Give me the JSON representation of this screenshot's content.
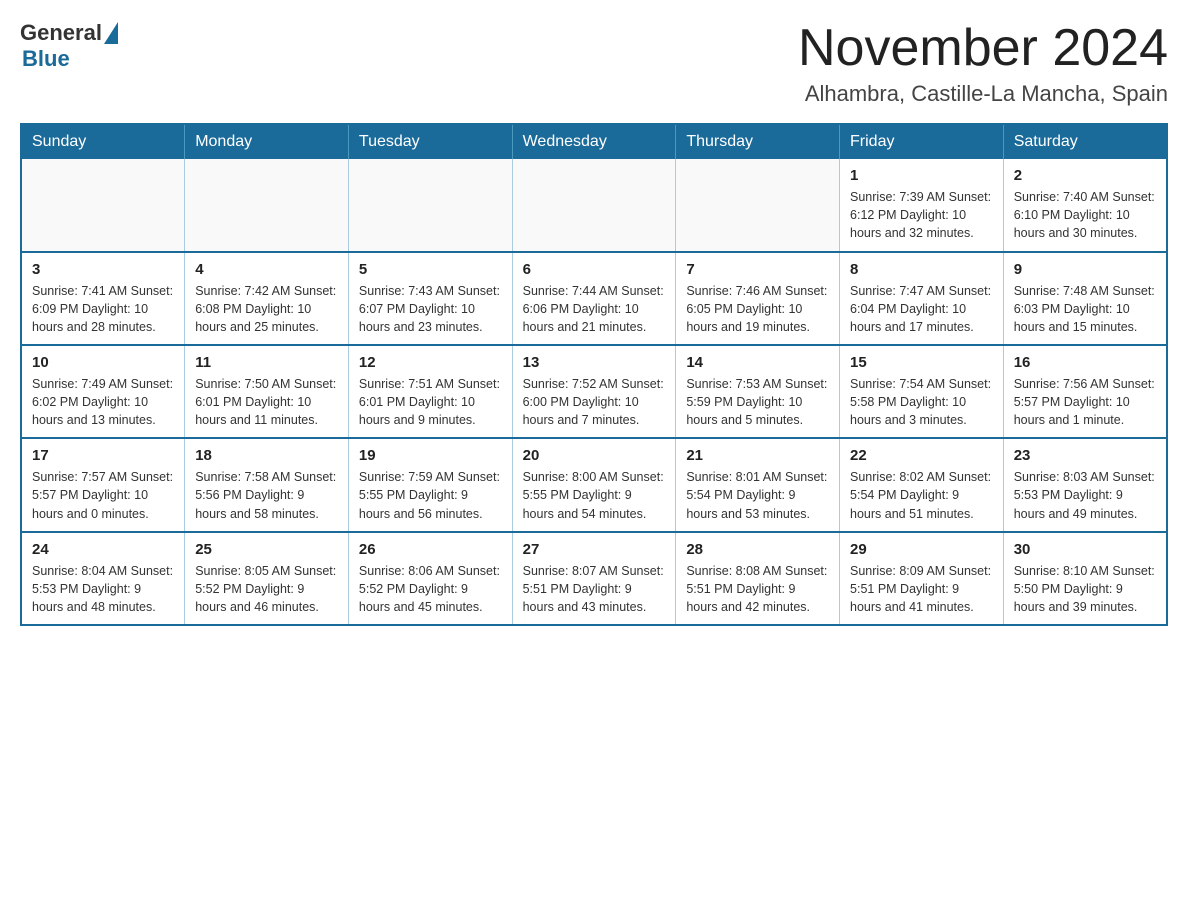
{
  "header": {
    "logo": {
      "general": "General",
      "blue": "Blue"
    },
    "title": "November 2024",
    "location": "Alhambra, Castille-La Mancha, Spain"
  },
  "calendar": {
    "days_of_week": [
      "Sunday",
      "Monday",
      "Tuesday",
      "Wednesday",
      "Thursday",
      "Friday",
      "Saturday"
    ],
    "weeks": [
      [
        {
          "day": "",
          "info": ""
        },
        {
          "day": "",
          "info": ""
        },
        {
          "day": "",
          "info": ""
        },
        {
          "day": "",
          "info": ""
        },
        {
          "day": "",
          "info": ""
        },
        {
          "day": "1",
          "info": "Sunrise: 7:39 AM\nSunset: 6:12 PM\nDaylight: 10 hours\nand 32 minutes."
        },
        {
          "day": "2",
          "info": "Sunrise: 7:40 AM\nSunset: 6:10 PM\nDaylight: 10 hours\nand 30 minutes."
        }
      ],
      [
        {
          "day": "3",
          "info": "Sunrise: 7:41 AM\nSunset: 6:09 PM\nDaylight: 10 hours\nand 28 minutes."
        },
        {
          "day": "4",
          "info": "Sunrise: 7:42 AM\nSunset: 6:08 PM\nDaylight: 10 hours\nand 25 minutes."
        },
        {
          "day": "5",
          "info": "Sunrise: 7:43 AM\nSunset: 6:07 PM\nDaylight: 10 hours\nand 23 minutes."
        },
        {
          "day": "6",
          "info": "Sunrise: 7:44 AM\nSunset: 6:06 PM\nDaylight: 10 hours\nand 21 minutes."
        },
        {
          "day": "7",
          "info": "Sunrise: 7:46 AM\nSunset: 6:05 PM\nDaylight: 10 hours\nand 19 minutes."
        },
        {
          "day": "8",
          "info": "Sunrise: 7:47 AM\nSunset: 6:04 PM\nDaylight: 10 hours\nand 17 minutes."
        },
        {
          "day": "9",
          "info": "Sunrise: 7:48 AM\nSunset: 6:03 PM\nDaylight: 10 hours\nand 15 minutes."
        }
      ],
      [
        {
          "day": "10",
          "info": "Sunrise: 7:49 AM\nSunset: 6:02 PM\nDaylight: 10 hours\nand 13 minutes."
        },
        {
          "day": "11",
          "info": "Sunrise: 7:50 AM\nSunset: 6:01 PM\nDaylight: 10 hours\nand 11 minutes."
        },
        {
          "day": "12",
          "info": "Sunrise: 7:51 AM\nSunset: 6:01 PM\nDaylight: 10 hours\nand 9 minutes."
        },
        {
          "day": "13",
          "info": "Sunrise: 7:52 AM\nSunset: 6:00 PM\nDaylight: 10 hours\nand 7 minutes."
        },
        {
          "day": "14",
          "info": "Sunrise: 7:53 AM\nSunset: 5:59 PM\nDaylight: 10 hours\nand 5 minutes."
        },
        {
          "day": "15",
          "info": "Sunrise: 7:54 AM\nSunset: 5:58 PM\nDaylight: 10 hours\nand 3 minutes."
        },
        {
          "day": "16",
          "info": "Sunrise: 7:56 AM\nSunset: 5:57 PM\nDaylight: 10 hours\nand 1 minute."
        }
      ],
      [
        {
          "day": "17",
          "info": "Sunrise: 7:57 AM\nSunset: 5:57 PM\nDaylight: 10 hours\nand 0 minutes."
        },
        {
          "day": "18",
          "info": "Sunrise: 7:58 AM\nSunset: 5:56 PM\nDaylight: 9 hours\nand 58 minutes."
        },
        {
          "day": "19",
          "info": "Sunrise: 7:59 AM\nSunset: 5:55 PM\nDaylight: 9 hours\nand 56 minutes."
        },
        {
          "day": "20",
          "info": "Sunrise: 8:00 AM\nSunset: 5:55 PM\nDaylight: 9 hours\nand 54 minutes."
        },
        {
          "day": "21",
          "info": "Sunrise: 8:01 AM\nSunset: 5:54 PM\nDaylight: 9 hours\nand 53 minutes."
        },
        {
          "day": "22",
          "info": "Sunrise: 8:02 AM\nSunset: 5:54 PM\nDaylight: 9 hours\nand 51 minutes."
        },
        {
          "day": "23",
          "info": "Sunrise: 8:03 AM\nSunset: 5:53 PM\nDaylight: 9 hours\nand 49 minutes."
        }
      ],
      [
        {
          "day": "24",
          "info": "Sunrise: 8:04 AM\nSunset: 5:53 PM\nDaylight: 9 hours\nand 48 minutes."
        },
        {
          "day": "25",
          "info": "Sunrise: 8:05 AM\nSunset: 5:52 PM\nDaylight: 9 hours\nand 46 minutes."
        },
        {
          "day": "26",
          "info": "Sunrise: 8:06 AM\nSunset: 5:52 PM\nDaylight: 9 hours\nand 45 minutes."
        },
        {
          "day": "27",
          "info": "Sunrise: 8:07 AM\nSunset: 5:51 PM\nDaylight: 9 hours\nand 43 minutes."
        },
        {
          "day": "28",
          "info": "Sunrise: 8:08 AM\nSunset: 5:51 PM\nDaylight: 9 hours\nand 42 minutes."
        },
        {
          "day": "29",
          "info": "Sunrise: 8:09 AM\nSunset: 5:51 PM\nDaylight: 9 hours\nand 41 minutes."
        },
        {
          "day": "30",
          "info": "Sunrise: 8:10 AM\nSunset: 5:50 PM\nDaylight: 9 hours\nand 39 minutes."
        }
      ]
    ]
  }
}
